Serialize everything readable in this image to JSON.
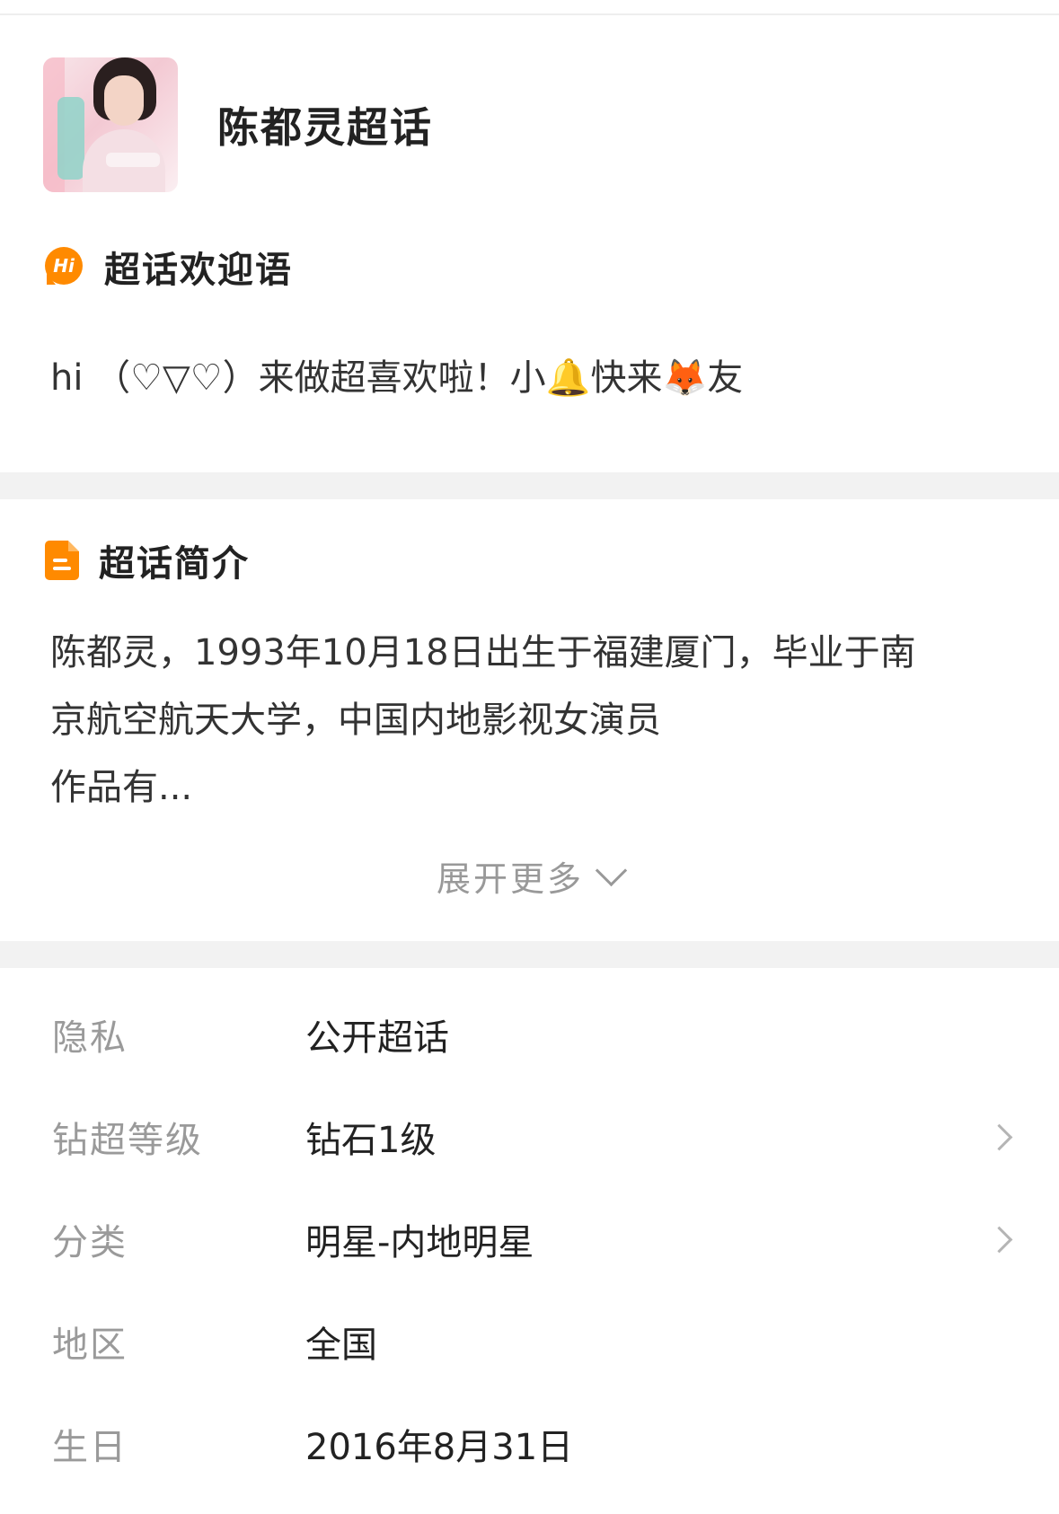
{
  "header": {
    "title": "陈都灵超话"
  },
  "welcome_section": {
    "title": "超话欢迎语",
    "icon_text": "Hi",
    "text": "hi （♡▽♡）来做超喜欢啦！小🔔快来🦊友"
  },
  "intro_section": {
    "title": "超话简介",
    "lines": [
      "陈都灵，1993年10月18日出生于福建厦门，毕业于南",
      "京航空航天大学，中国内地影视女演员",
      "作品有..."
    ],
    "expand_label": "展开更多"
  },
  "info": {
    "rows": [
      {
        "key": "隐私",
        "value": "公开超话",
        "has_arrow": false
      },
      {
        "key": "钻超等级",
        "value": "钻石1级",
        "has_arrow": true
      },
      {
        "key": "分类",
        "value": "明星-内地明星",
        "has_arrow": true
      },
      {
        "key": "地区",
        "value": "全国",
        "has_arrow": false
      },
      {
        "key": "生日",
        "value": "2016年8月31日",
        "has_arrow": false
      }
    ]
  },
  "colors": {
    "accent": "#ff8a00",
    "divider": "#f2f2f2",
    "label": "#9a9a9a",
    "text": "#222222"
  }
}
